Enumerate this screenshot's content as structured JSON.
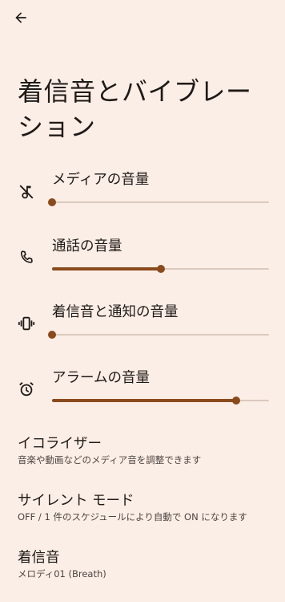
{
  "page_title": "着信音とバイブレーション",
  "icons": {
    "back": "back-arrow-icon",
    "media": "music-note-off-icon",
    "call": "phone-icon",
    "ring": "vibrate-icon",
    "alarm": "alarm-clock-icon"
  },
  "volumes": [
    {
      "label": "メディアの音量",
      "level": 0.0
    },
    {
      "label": "通話の音量",
      "level": 0.5
    },
    {
      "label": "着信音と通知の音量",
      "level": 0.0
    },
    {
      "label": "アラームの音量",
      "level": 0.85
    }
  ],
  "prefs": [
    {
      "title": "イコライザー",
      "summary": "音楽や動画などのメディア音を調整できます"
    },
    {
      "title": "サイレント モード",
      "summary": "OFF / 1 件のスケジュールにより自動で ON になります"
    },
    {
      "title": "着信音",
      "summary": "メロディ01 (Breath)"
    }
  ],
  "colors": {
    "background": "#fbeee6",
    "accent": "#8a4a1c",
    "track": "#dbc9bd",
    "text": "#1f1a17"
  }
}
